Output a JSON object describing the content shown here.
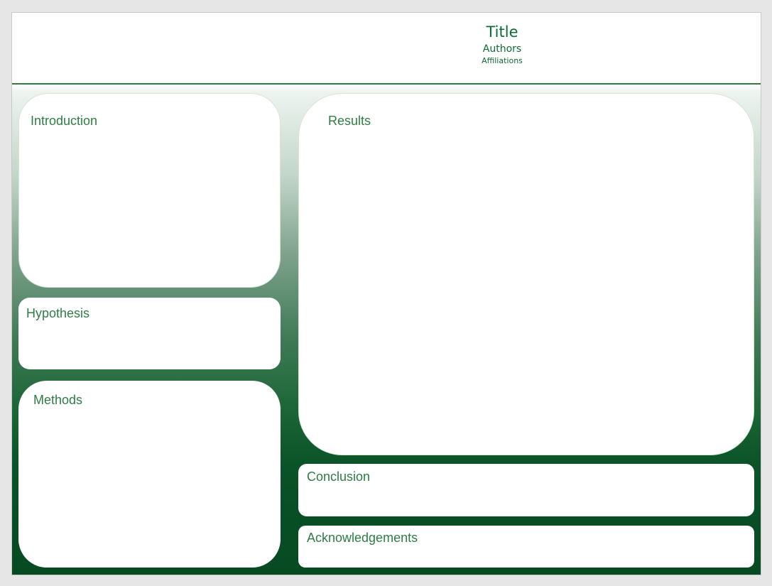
{
  "header": {
    "title": "Title",
    "authors": "Authors",
    "affiliations": "Affiliations"
  },
  "sections": {
    "introduction": "Introduction",
    "hypothesis": "Hypothesis",
    "methods": "Methods",
    "results": "Results",
    "conclusion": "Conclusion",
    "acknowledgements": "Acknowledgements"
  },
  "colors": {
    "accent": "#2e7d45",
    "title_text": "#0f6b34",
    "background_dark": "#064a22",
    "background_light": "#ffffff"
  }
}
